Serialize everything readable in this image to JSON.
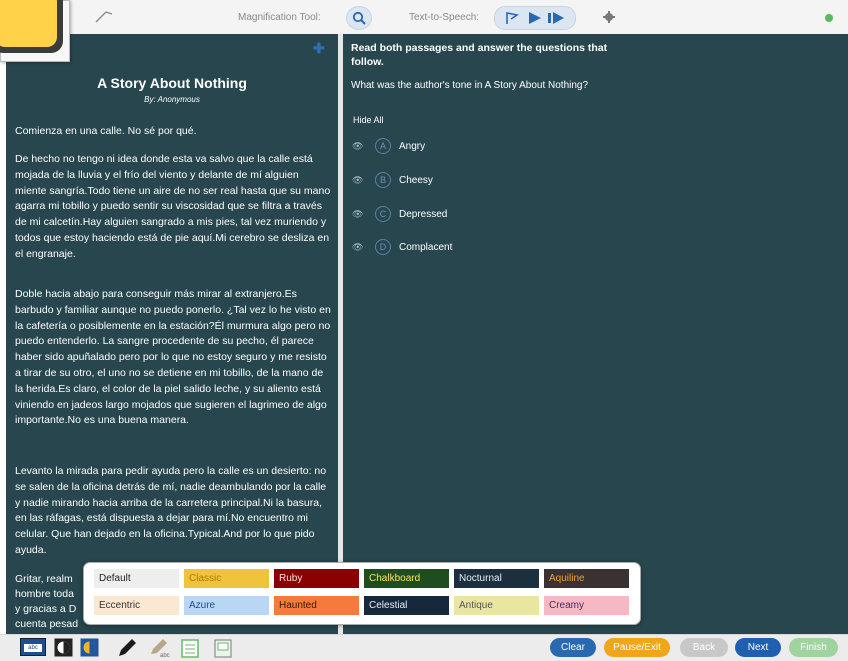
{
  "topbar": {
    "magnification_label": "Magnification Tool:",
    "tts_label": "Text-to-Speech:",
    "icons": [
      "search-icon",
      "flag-icon",
      "play-icon",
      "skip-icon",
      "gear-icon",
      "status-dot-icon"
    ],
    "status_color": "#5cb85c"
  },
  "passage": {
    "title": "A Story About Nothing",
    "byline": "By: Anonymous",
    "paragraphs": [
      "Comienza en una calle. No sé por qué.",
      "De hecho no tengo ni idea donde esta va salvo que la calle está mojada de la lluvia y el frío del viento y delante de mí alguien miente sangría.Todo tiene un aire de no ser real hasta que su mano agarra mi tobillo y puedo sentir su viscosidad que se filtra a través de mi calcetín.Hay alguien sangrado a mis pies, tal vez muriendo y todos que estoy haciendo está de pie aquí.Mi cerebro se desliza en el engranaje.",
      "Doble hacia abajo para conseguir más mirar al extranjero.Es barbudo y familiar aunque no puedo ponerlo. ¿Tal vez lo he visto en la cafetería o posiblemente en la estación?Él murmura algo pero no puedo entenderlo. La sangre procedente de su pecho, él parece haber sido apuñalado pero por lo que no estoy seguro y me resisto a tirar de su otro, el uno no se detiene en mi tobillo, de la mano de la herida.Es claro, el color de la piel salido leche, y su aliento está viniendo en jadeos largo mojados que sugieren el lagrimeo de algo importante.No es una buena manera.",
      "Levanto la mirada para pedir ayuda pero la calle es un desierto: no se salen de la oficina detrás de mí, nadie deambulando por la calle y nadie mirando hacia arriba de la carretera principal.Ni la basura, en las ráfagas, está dispuesta a dejar para mí.No encuentro mi celular. Que han dejado en la oficina.Typical.And por lo que pido ayuda.",
      "Gritar, realm",
      "hombre toda",
      "y gracias a D",
      "cuenta pesad"
    ]
  },
  "question": {
    "instructions": "Read both passages and answer the questions that follow.",
    "prompt": "What was the author's tone in A Story About Nothing?",
    "hide_all_label": "Hide All",
    "options": [
      {
        "letter": "A",
        "text": "Angry"
      },
      {
        "letter": "B",
        "text": "Cheesy"
      },
      {
        "letter": "C",
        "text": "Depressed"
      },
      {
        "letter": "D",
        "text": "Complacent"
      }
    ]
  },
  "palette": {
    "themes": [
      {
        "label": "Default",
        "bg": "#eeeeee",
        "fg": "#222222"
      },
      {
        "label": "Classic",
        "bg": "#f0c33c",
        "fg": "#b07a00"
      },
      {
        "label": "Ruby",
        "bg": "#8b0000",
        "fg": "#ffd9d9"
      },
      {
        "label": "Chalkboard",
        "bg": "#1f4d1f",
        "fg": "#f5e663"
      },
      {
        "label": "Nocturnal",
        "bg": "#1c2f3f",
        "fg": "#e8eef2"
      },
      {
        "label": "Aquiline",
        "bg": "#3b3132",
        "fg": "#e8a33a"
      },
      {
        "label": "Eccentric",
        "bg": "#fbe8d2",
        "fg": "#333333"
      },
      {
        "label": "Azure",
        "bg": "#b9d7f5",
        "fg": "#1f4e88"
      },
      {
        "label": "Haunted",
        "bg": "#f47b3a",
        "fg": "#3a1a05"
      },
      {
        "label": "Celestial",
        "bg": "#16283c",
        "fg": "#e8eef4"
      },
      {
        "label": "Antique",
        "bg": "#e8e6a0",
        "fg": "#555555"
      },
      {
        "label": "Creamy",
        "bg": "#f6b8c2",
        "fg": "#4a2a60"
      }
    ]
  },
  "toolbar": {
    "tool_icons": [
      "line-reader-icon",
      "contrast-icon",
      "color-theme-icon",
      "pen-icon",
      "highlighter-icon",
      "notepad-icon",
      "sticky-note-icon"
    ],
    "line_reader_text": "abc",
    "clear_label": "Clear",
    "pause_label": "Pause/Exit",
    "back_label": "Back",
    "next_label": "Next",
    "finish_label": "Finish",
    "colors": {
      "clear": "#2a68b0",
      "pause": "#f0a51a",
      "back": "#c8c8c8",
      "next": "#1f5fb0",
      "finish": "#9fd49f"
    }
  }
}
